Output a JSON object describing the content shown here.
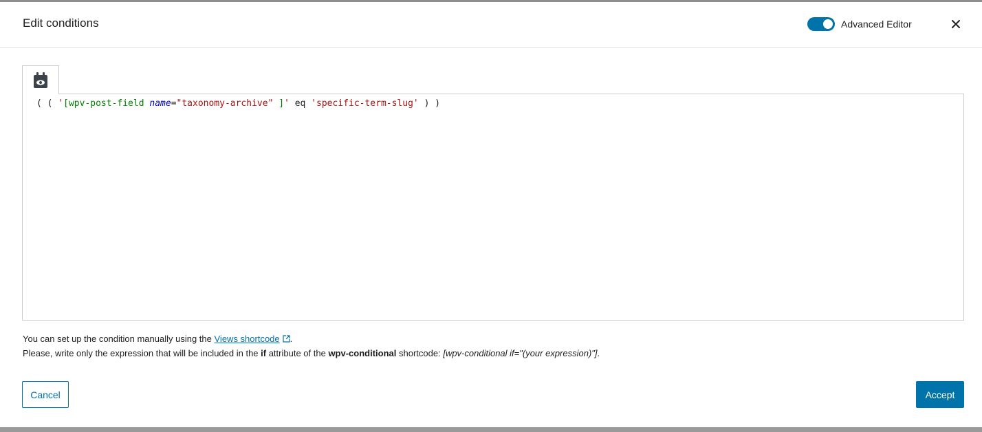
{
  "header": {
    "title": "Edit conditions",
    "toggle_label": "Advanced Editor",
    "toggle_on": true,
    "close_icon": "close-icon"
  },
  "toolbar": {
    "tab_icon": "calendar-eye-icon"
  },
  "editor": {
    "open1": "( ( ",
    "str_open": "'",
    "sc_name": "[wpv-post-field ",
    "attr_name": "name",
    "equals": "=",
    "attr_value": "\"taxonomy-archive\"",
    "sc_close": " ]",
    "str_close": "'",
    "op": " eq ",
    "term": "'specific-term-slug'",
    "close1": " ) )"
  },
  "help": {
    "line1_prefix": "You can set up the condition manually using the ",
    "link_text": "Views shortcode",
    "line1_suffix": ".",
    "line2_a": "Please, write only the expression that will be included in the ",
    "line2_if": "if",
    "line2_b": " attribute of the ",
    "line2_wpv": "wpv-conditional",
    "line2_c": " shortcode: ",
    "line2_example": "[wpv-conditional if=\"(your expression)\"]",
    "line2_end": "."
  },
  "footer": {
    "cancel_label": "Cancel",
    "accept_label": "Accept"
  },
  "colors": {
    "accent": "#0073aa",
    "string": "#aa1111",
    "shortcode": "#008000",
    "attribute": "#0000cc"
  }
}
